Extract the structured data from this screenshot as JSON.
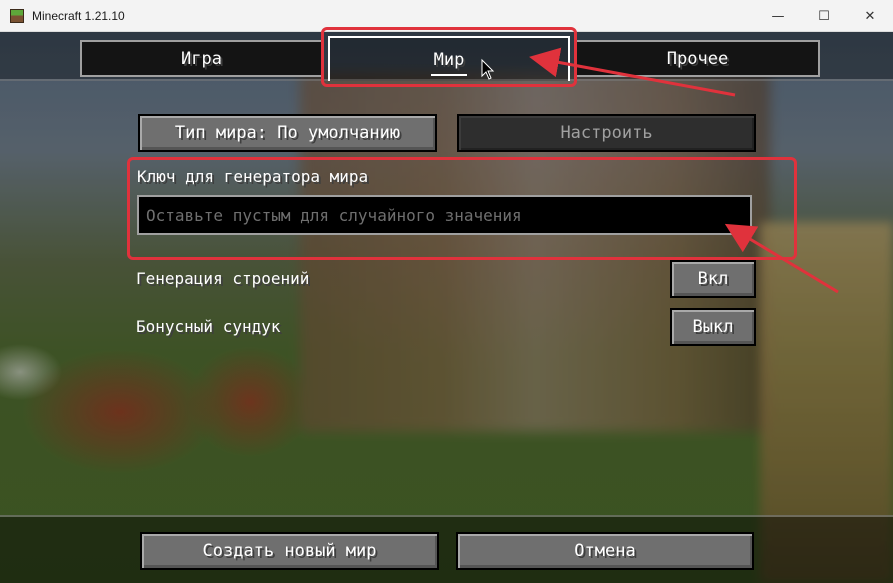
{
  "window": {
    "title": "Minecraft 1.21.10",
    "app_icon": "minecraft-grass-block-icon",
    "controls": [
      {
        "name": "minimize-icon",
        "glyph": "—"
      },
      {
        "name": "maximize-icon",
        "glyph": "☐"
      },
      {
        "name": "close-icon",
        "glyph": "✕"
      }
    ]
  },
  "tabs": [
    {
      "label": "Игра",
      "selected": false
    },
    {
      "label": "Мир",
      "selected": true
    },
    {
      "label": "Прочее",
      "selected": false
    }
  ],
  "world": {
    "world_type_button": "Тип мира: По умолчанию",
    "customize_button": "Настроить",
    "customize_enabled": false,
    "seed_label": "Ключ для генератора мира",
    "seed_value": "",
    "seed_placeholder": "Оставьте пустым для случайного значения",
    "structures_label": "Генерация строений",
    "structures_value": "Вкл",
    "bonus_chest_label": "Бонусный сундук",
    "bonus_chest_value": "Выкл"
  },
  "footer": {
    "create_button": "Создать новый мир",
    "cancel_button": "Отмена"
  },
  "annotations": {
    "highlight_color": "#e0323c"
  }
}
